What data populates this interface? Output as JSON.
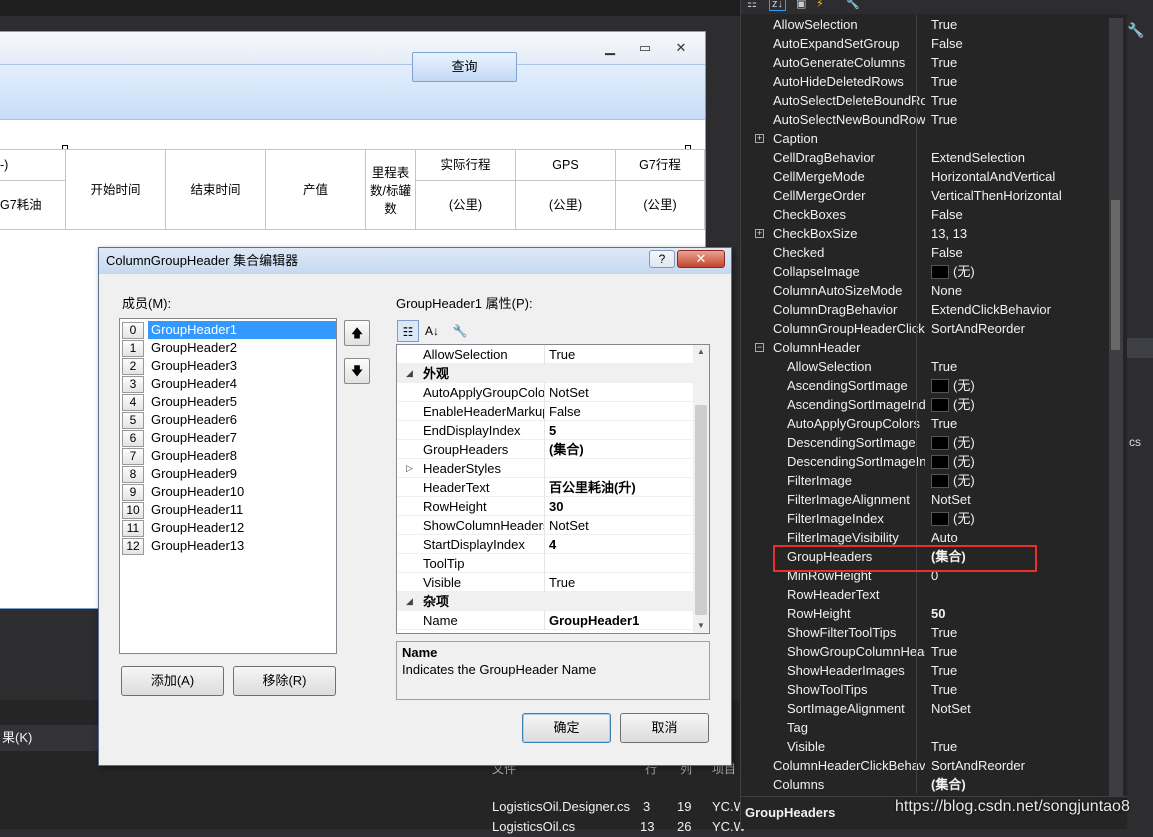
{
  "designer": {
    "query_button": "查询",
    "grid_headers": {
      "g7_fuel_partial": "G7耗油",
      "start_time": "开始时间",
      "end_time": "结束时间",
      "output": "产值",
      "odometer": "里程表数/标罐数",
      "actual_trip": "实际行程",
      "actual_trip_unit": "(公里)",
      "gps": "GPS",
      "gps_unit": "(公里)",
      "g7_trip": "G7行程",
      "g7_trip_unit": "(公里)",
      "left_partial": "-)"
    }
  },
  "dialog": {
    "title": "ColumnGroupHeader 集合编辑器",
    "help": "?",
    "close": "✕",
    "members_label": "成员(M):",
    "members": [
      {
        "index": "0",
        "name": "GroupHeader1"
      },
      {
        "index": "1",
        "name": "GroupHeader2"
      },
      {
        "index": "2",
        "name": "GroupHeader3"
      },
      {
        "index": "3",
        "name": "GroupHeader4"
      },
      {
        "index": "4",
        "name": "GroupHeader5"
      },
      {
        "index": "5",
        "name": "GroupHeader6"
      },
      {
        "index": "6",
        "name": "GroupHeader7"
      },
      {
        "index": "7",
        "name": "GroupHeader8"
      },
      {
        "index": "8",
        "name": "GroupHeader9"
      },
      {
        "index": "9",
        "name": "GroupHeader10"
      },
      {
        "index": "10",
        "name": "GroupHeader11"
      },
      {
        "index": "11",
        "name": "GroupHeader12"
      },
      {
        "index": "12",
        "name": "GroupHeader13"
      }
    ],
    "add_button": "添加(A)",
    "remove_button": "移除(R)",
    "props_label": "GroupHeader1 属性(P):",
    "props": [
      {
        "name": "AllowSelection",
        "value": "True"
      },
      {
        "name": "外观",
        "value": "",
        "category": true
      },
      {
        "name": "AutoApplyGroupColors",
        "value": "NotSet"
      },
      {
        "name": "EnableHeaderMarkup",
        "value": "False"
      },
      {
        "name": "EndDisplayIndex",
        "value": "5",
        "bold": true
      },
      {
        "name": "GroupHeaders",
        "value": "(集合)",
        "bold": true
      },
      {
        "name": "HeaderStyles",
        "value": "",
        "expandable": true
      },
      {
        "name": "HeaderText",
        "value": "百公里耗油(升)",
        "bold": true
      },
      {
        "name": "RowHeight",
        "value": "30",
        "bold": true
      },
      {
        "name": "ShowColumnHeaders",
        "value": "NotSet"
      },
      {
        "name": "StartDisplayIndex",
        "value": "4",
        "bold": true
      },
      {
        "name": "ToolTip",
        "value": ""
      },
      {
        "name": "Visible",
        "value": "True"
      },
      {
        "name": "杂项",
        "value": "",
        "category": true
      },
      {
        "name": "Name",
        "value": "GroupHeader1",
        "bold": true
      }
    ],
    "desc_name": "Name",
    "desc_text": "Indicates the GroupHeader Name",
    "ok_button": "确定",
    "cancel_button": "取消"
  },
  "property_panel": {
    "rows": [
      {
        "name": "AllowSelection",
        "value": "True"
      },
      {
        "name": "AutoExpandSetGroup",
        "value": "False"
      },
      {
        "name": "AutoGenerateColumns",
        "value": "True"
      },
      {
        "name": "AutoHideDeletedRows",
        "value": "True"
      },
      {
        "name": "AutoSelectDeleteBoundRows",
        "value": "True"
      },
      {
        "name": "AutoSelectNewBoundRows",
        "value": "True"
      },
      {
        "name": "Caption",
        "value": "",
        "expand": "+"
      },
      {
        "name": "CellDragBehavior",
        "value": "ExtendSelection"
      },
      {
        "name": "CellMergeMode",
        "value": "HorizontalAndVertical"
      },
      {
        "name": "CellMergeOrder",
        "value": "VerticalThenHorizontal"
      },
      {
        "name": "CheckBoxes",
        "value": "False"
      },
      {
        "name": "CheckBoxSize",
        "value": "13, 13",
        "expand": "+"
      },
      {
        "name": "Checked",
        "value": "False"
      },
      {
        "name": "CollapseImage",
        "value": "(无)",
        "swatch": true
      },
      {
        "name": "ColumnAutoSizeMode",
        "value": "None"
      },
      {
        "name": "ColumnDragBehavior",
        "value": "ExtendClickBehavior"
      },
      {
        "name": "ColumnGroupHeaderClickBehavior",
        "value": "SortAndReorder"
      },
      {
        "name": "ColumnHeader",
        "value": "",
        "expand": "-"
      },
      {
        "name": "AllowSelection",
        "value": "True",
        "sub": true
      },
      {
        "name": "AscendingSortImage",
        "value": "(无)",
        "sub": true,
        "swatch": true
      },
      {
        "name": "AscendingSortImageIndex",
        "value": "(无)",
        "sub": true,
        "swatch": true
      },
      {
        "name": "AutoApplyGroupColors",
        "value": "True",
        "sub": true
      },
      {
        "name": "DescendingSortImage",
        "value": "(无)",
        "sub": true,
        "swatch": true
      },
      {
        "name": "DescendingSortImageIndex",
        "value": "(无)",
        "sub": true,
        "swatch": true
      },
      {
        "name": "FilterImage",
        "value": "(无)",
        "sub": true,
        "swatch": true
      },
      {
        "name": "FilterImageAlignment",
        "value": "NotSet",
        "sub": true
      },
      {
        "name": "FilterImageIndex",
        "value": "(无)",
        "sub": true,
        "swatch": true
      },
      {
        "name": "FilterImageVisibility",
        "value": "Auto",
        "sub": true
      },
      {
        "name": "GroupHeaders",
        "value": "(集合)",
        "sub": true,
        "bold": true
      },
      {
        "name": "MinRowHeight",
        "value": "0",
        "sub": true
      },
      {
        "name": "RowHeaderText",
        "value": "",
        "sub": true
      },
      {
        "name": "RowHeight",
        "value": "50",
        "sub": true,
        "bold": true
      },
      {
        "name": "ShowFilterToolTips",
        "value": "True",
        "sub": true
      },
      {
        "name": "ShowGroupColumnHeaders",
        "value": "True",
        "sub": true
      },
      {
        "name": "ShowHeaderImages",
        "value": "True",
        "sub": true
      },
      {
        "name": "ShowToolTips",
        "value": "True",
        "sub": true
      },
      {
        "name": "SortImageAlignment",
        "value": "NotSet",
        "sub": true
      },
      {
        "name": "Tag",
        "value": "",
        "sub": true
      },
      {
        "name": "Visible",
        "value": "True",
        "sub": true
      },
      {
        "name": "ColumnHeaderClickBehavior",
        "value": "SortAndReorder"
      },
      {
        "name": "Columns",
        "value": "(集合)",
        "bold": true
      }
    ],
    "desc_title": "GroupHeaders",
    "right_edge_text": "cs"
  },
  "bottom": {
    "tab_label": "果(K)",
    "list_header": {
      "c1": "文件",
      "c2": "行",
      "c3": "列",
      "c4": "项目"
    },
    "rows": [
      {
        "file": "LogisticsOil.Designer.cs",
        "line": "3",
        "col": "19",
        "proj": "YC.W"
      },
      {
        "file": "LogisticsOil.cs",
        "line": "13",
        "col": "26",
        "proj": "YC.W"
      }
    ]
  },
  "watermark": "https://blog.csdn.net/songjuntao8"
}
